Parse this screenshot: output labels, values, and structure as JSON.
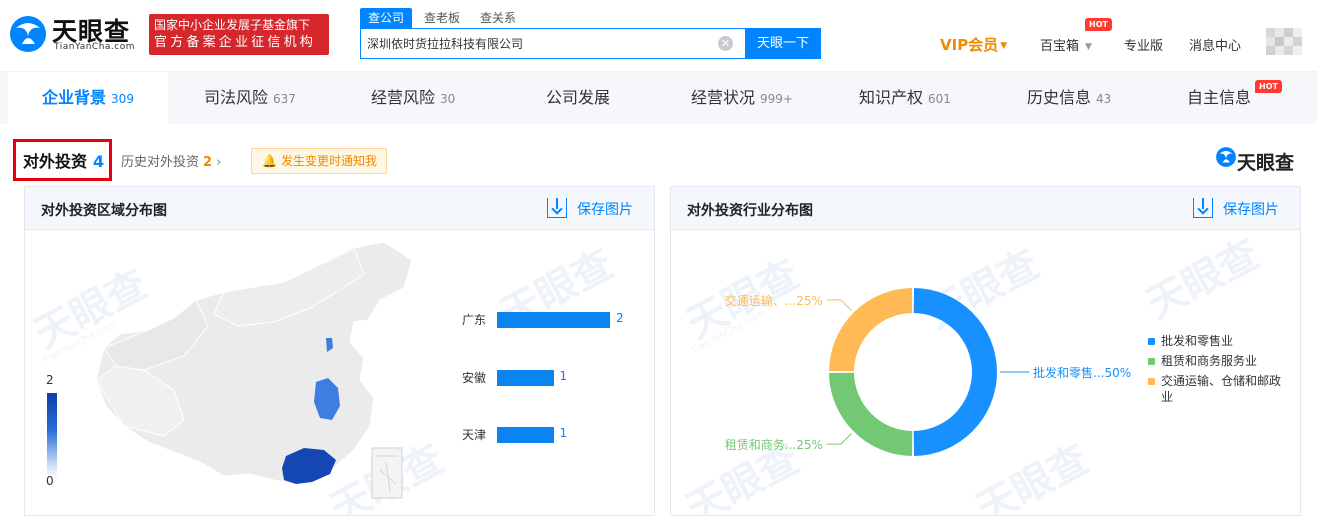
{
  "header": {
    "logo_text": "天眼查",
    "logo_sub": "TianYanCha.com",
    "gov_badge_line1": "国家中小企业发展子基金旗下",
    "gov_badge_line2": "官方备案企业征信机构",
    "search_tabs": [
      "查公司",
      "查老板",
      "查关系"
    ],
    "search_value": "深圳依时货拉拉科技有限公司",
    "search_button": "天眼一下",
    "vip": "VIP会员",
    "baibaoxiang": "百宝箱",
    "hot_badge": "HOT",
    "pro": "专业版",
    "messages": "消息中心"
  },
  "tabs": [
    {
      "label": "企业背景",
      "count": "309"
    },
    {
      "label": "司法风险",
      "count": "637"
    },
    {
      "label": "经营风险",
      "count": "30"
    },
    {
      "label": "公司发展",
      "count": ""
    },
    {
      "label": "经营状况",
      "count": "999+"
    },
    {
      "label": "知识产权",
      "count": "601"
    },
    {
      "label": "历史信息",
      "count": "43"
    },
    {
      "label": "自主信息",
      "count": ""
    }
  ],
  "tab_hot": "HOT",
  "section": {
    "title": "对外投资",
    "count": "4",
    "history_label": "历史对外投资",
    "history_count": "2",
    "notify": "发生变更时通知我",
    "brand": "天眼查"
  },
  "region_panel": {
    "title": "对外投资区域分布图",
    "save": "保存图片",
    "scale_max": "2",
    "scale_min": "0"
  },
  "industry_panel": {
    "title": "对外投资行业分布图",
    "save": "保存图片"
  },
  "watermark": {
    "text": "天眼查",
    "sub": "TianYanCha.com"
  },
  "chart_data": [
    {
      "type": "bar",
      "categories": [
        "广东",
        "安徽",
        "天津"
      ],
      "values": [
        2,
        1,
        1
      ],
      "colors": {
        "bar": "#0a84f0",
        "map_high": "#0b3fa6",
        "map_low": "#c9dcf5"
      }
    },
    {
      "type": "pie",
      "categories": [
        "批发和零售业",
        "租赁和商务服务业",
        "交通运输、仓储和邮政业"
      ],
      "values": [
        50,
        25,
        25
      ],
      "slice_labels": [
        "批发和零售...50%",
        "租赁和商务...25%",
        "交通运输、...25%"
      ],
      "colors": [
        "#1890ff",
        "#73c973",
        "#ffb955"
      ]
    }
  ]
}
